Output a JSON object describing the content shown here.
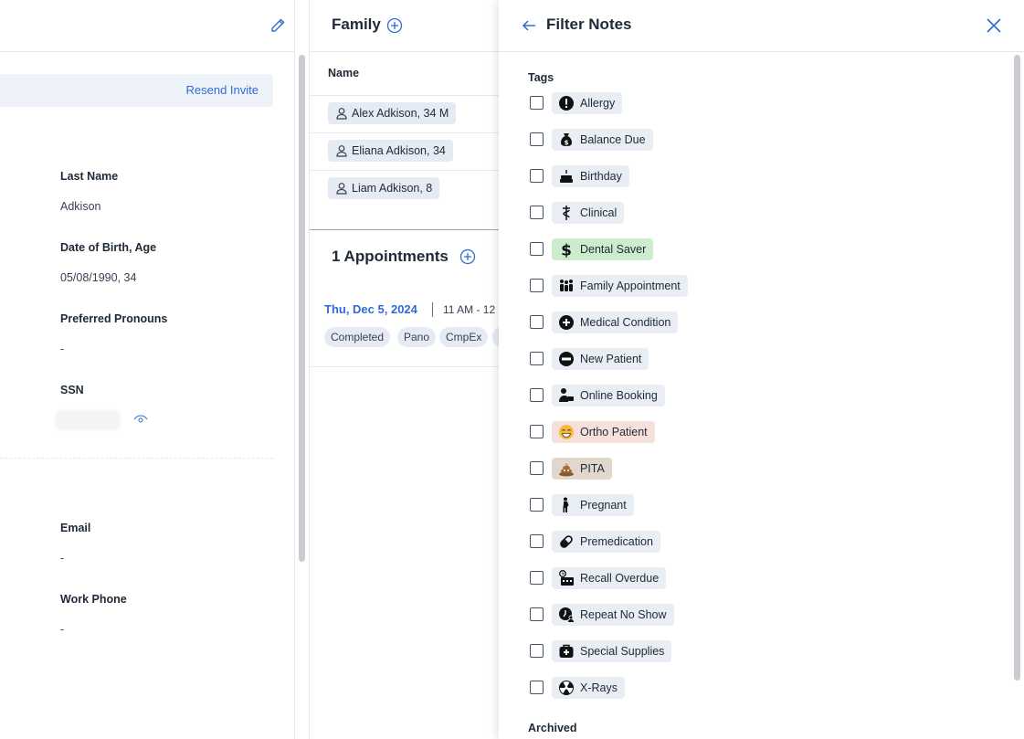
{
  "profile": {
    "resend_label": "Resend Invite",
    "fields": [
      {
        "label": "Last Name",
        "value": "Adkison"
      },
      {
        "label": "Date of Birth, Age",
        "value": "05/08/1990, 34"
      },
      {
        "label": "Preferred Pronouns",
        "value": "-"
      },
      {
        "label": "SSN",
        "value": ""
      },
      {
        "label": "Email",
        "value": "-"
      },
      {
        "label": "Work Phone",
        "value": "-"
      }
    ]
  },
  "family": {
    "title": "Family",
    "column_name": "Name",
    "members": [
      "Alex Adkison, 34 M",
      "Eliana Adkison, 34",
      "Liam Adkison, 8"
    ]
  },
  "appointments": {
    "title": "1 Appointments",
    "date": "Thu, Dec 5, 2024",
    "time": "11 AM - 12",
    "pills": [
      "Completed",
      "Pano",
      "CmpEx"
    ]
  },
  "filter": {
    "title": "Filter Notes",
    "tags_label": "Tags",
    "archived_label": "Archived",
    "tags": [
      {
        "label": "Allergy",
        "icon": "exclamation-circle-icon",
        "bg": "#e9edf4"
      },
      {
        "label": "Balance Due",
        "icon": "money-bag-icon",
        "bg": "#e9edf4"
      },
      {
        "label": "Birthday",
        "icon": "cake-icon",
        "bg": "#e9edf4"
      },
      {
        "label": "Clinical",
        "icon": "caduceus-icon",
        "bg": "#e9edf4"
      },
      {
        "label": "Dental Saver",
        "icon": "dollar-icon",
        "bg": "#cdeccd"
      },
      {
        "label": "Family Appointment",
        "icon": "family-icon",
        "bg": "#e9edf4"
      },
      {
        "label": "Medical Condition",
        "icon": "plus-circle-icon",
        "bg": "#e9edf4"
      },
      {
        "label": "New Patient",
        "icon": "new-badge-icon",
        "bg": "#e9edf4"
      },
      {
        "label": "Online Booking",
        "icon": "user-computer-icon",
        "bg": "#e9edf4"
      },
      {
        "label": "Ortho Patient",
        "icon": "grin-emoji-icon",
        "bg": "#f6e0dc"
      },
      {
        "label": "PITA",
        "icon": "poop-emoji-icon",
        "bg": "#e2d7cc"
      },
      {
        "label": "Pregnant",
        "icon": "pregnant-person-icon",
        "bg": "#e9edf4"
      },
      {
        "label": "Premedication",
        "icon": "pill-icon",
        "bg": "#e9edf4"
      },
      {
        "label": "Recall Overdue",
        "icon": "calendar-clock-icon",
        "bg": "#e9edf4"
      },
      {
        "label": "Repeat No Show",
        "icon": "clock-user-icon",
        "bg": "#e9edf4"
      },
      {
        "label": "Special Supplies",
        "icon": "medkit-icon",
        "bg": "#e9edf4"
      },
      {
        "label": "X-Rays",
        "icon": "radiation-icon",
        "bg": "#e9edf4"
      }
    ]
  },
  "colors": {
    "accent": "#2f6bd8",
    "chip": "#e9edf4",
    "resend_row": "#eef3fa"
  }
}
